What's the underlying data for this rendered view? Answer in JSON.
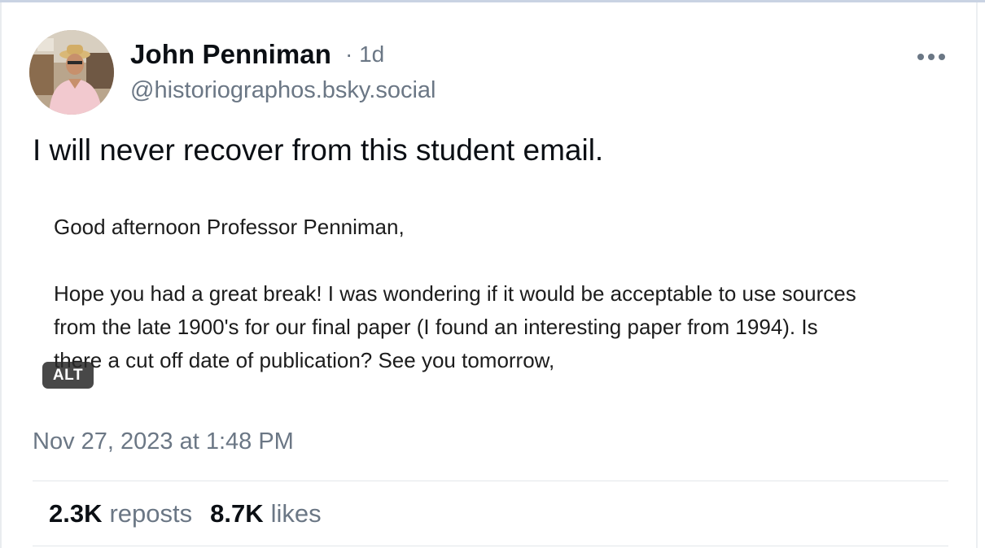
{
  "author": {
    "name": "John Penniman",
    "separator_time": "· 1d",
    "handle": "@historiographos.bsky.social"
  },
  "post": {
    "text": "I will never recover from this student email."
  },
  "image": {
    "greeting": "Good afternoon Professor Penniman,",
    "body_line_1": "Hope you had a great break! I was wondering if it would be acceptable to use sources",
    "body_line_2": "from the late 1900's for our final paper (I found an interesting paper from 1994). Is",
    "body_line_3": "there a cut off date of publication? See you tomorrow,",
    "alt_label": "ALT"
  },
  "meta": {
    "timestamp": "Nov 27, 2023 at 1:48 PM"
  },
  "stats": {
    "reposts_count": "2.3K",
    "reposts_label": "reposts",
    "likes_count": "8.7K",
    "likes_label": "likes"
  },
  "icons": {
    "more": "more-horizontal-icon",
    "avatar": "avatar"
  },
  "colors": {
    "text_primary": "#0b0f14",
    "text_secondary": "#6b7785",
    "divider": "#e3e6ea",
    "alt_badge_bg": "#282828"
  }
}
